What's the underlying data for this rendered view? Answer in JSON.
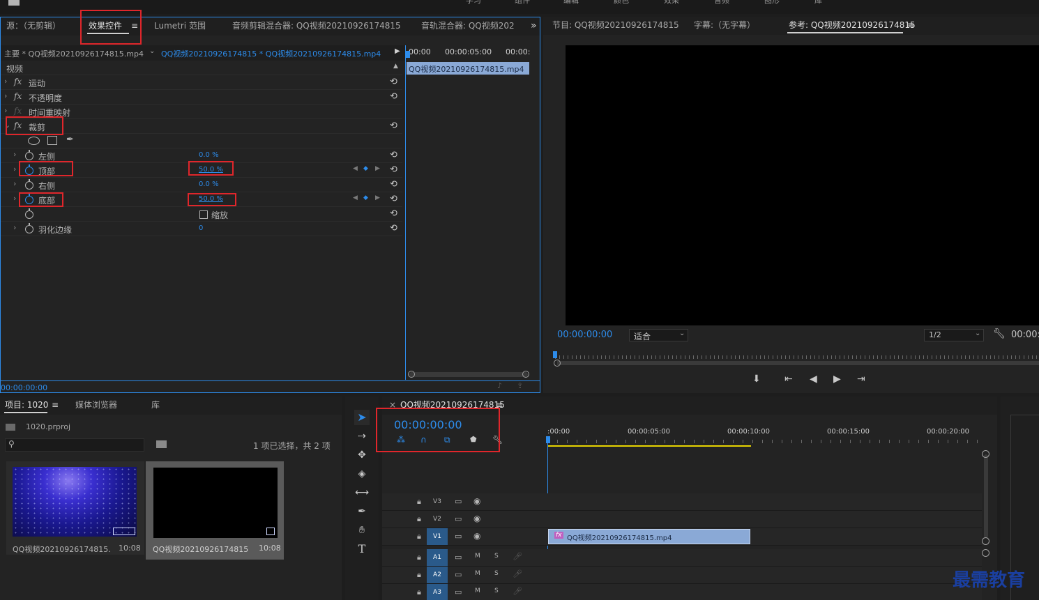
{
  "top_bar": {
    "workspace_tabs": [
      "学习",
      "组件",
      "编辑",
      "颜色",
      "效果",
      "音频",
      "图形",
      "库"
    ]
  },
  "source_panel": {
    "tabs": [
      "源：（无剪辑）",
      "效果控件",
      "Lumetri 范围",
      "音频剪辑混合器: QQ视频20210926174815",
      "音轨混合器: QQ视频202"
    ],
    "menu_icon": "≡",
    "overflow": "»",
    "clip_master": "主要 * QQ视频20210926174815.mp4",
    "clip_sequence": "QQ视频20210926174815 * QQ视频20210926174815.mp4",
    "ruler": [
      "00:00",
      "00:00:05:00",
      "00:00:"
    ],
    "timeline_clip": "QQ视频20210926174815.mp4",
    "section_video": "视频",
    "effects": {
      "motion": "运动",
      "opacity": "不透明度",
      "time_remap": "时间重映射",
      "crop": "裁剪"
    },
    "params": {
      "left_label": "左侧",
      "left_value": "0.0 %",
      "top_label": "顶部",
      "top_value": "50.0 %",
      "right_label": "右侧",
      "right_value": "0.0 %",
      "bottom_label": "底部",
      "bottom_value": "50.0 %",
      "zoom_label": "缩放",
      "feather_label": "羽化边缘",
      "feather_value": "0"
    },
    "timecode": "00:00:00:00"
  },
  "program_panel": {
    "tabs": [
      "节目: QQ视频20210926174815",
      "字幕:（无字幕）",
      "参考: QQ视频20210926174815"
    ],
    "menu_icon": "≡",
    "timecode": "00:00:00:00",
    "fit": "适合",
    "resolution": "1/2",
    "timecode_right": "00:00:"
  },
  "project_panel": {
    "tabs": [
      "项目: 1020",
      "媒体浏览器",
      "库"
    ],
    "menu_icon": "≡",
    "file": "1020.prproj",
    "selection_status": "1 项已选择，共 2 项",
    "items": [
      {
        "name": "QQ视频20210926174815...",
        "duration": "10:08"
      },
      {
        "name": "QQ视频20210926174815",
        "duration": "10:08"
      }
    ]
  },
  "timeline_panel": {
    "tab": "QQ视频20210926174815",
    "close_icon": "×",
    "menu_icon": "≡",
    "timecode": "00:00:00:00",
    "ruler": [
      ":00:00",
      "00:00:05:00",
      "00:00:10:00",
      "00:00:15:00",
      "00:00:20:00"
    ],
    "video_tracks": [
      "V3",
      "V2",
      "V1"
    ],
    "audio_tracks": [
      "A1",
      "A2",
      "A3"
    ],
    "mute": "M",
    "solo": "S",
    "clip": "QQ视频20210926174815.mp4",
    "clip_fx": "fx"
  },
  "watermark": "最需教育",
  "colors": {
    "accent_blue": "#2d8ceb",
    "highlight": "#e0262b",
    "clip_blue": "#8aa9d6",
    "work_area": "#e8d400"
  }
}
